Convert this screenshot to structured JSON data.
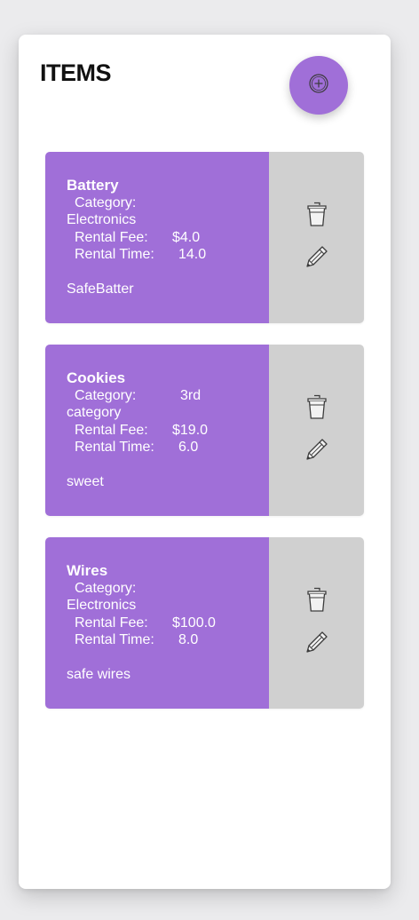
{
  "header": {
    "title": "ITEMS",
    "add_icon": "plus-circle-icon"
  },
  "colors": {
    "accent": "#a06fd8",
    "actions_bg": "#d0d0d0",
    "panel_bg": "#ffffff",
    "page_bg": "#ebebed"
  },
  "labels": {
    "category": "Category:",
    "rental_fee": "Rental Fee:",
    "rental_time": "Rental Time:"
  },
  "items": [
    {
      "name": "Battery",
      "category_line1": "",
      "category_line2": "Electronics",
      "rental_fee": "$4.0",
      "rental_time": "14.0",
      "description": "SafeBatter"
    },
    {
      "name": "Cookies",
      "category_line1": "3rd",
      "category_line2": "category",
      "rental_fee": "$19.0",
      "rental_time": "6.0",
      "description": "sweet"
    },
    {
      "name": "Wires",
      "category_line1": "",
      "category_line2": "Electronics",
      "rental_fee": "$100.0",
      "rental_time": "8.0",
      "description": "safe wires"
    }
  ]
}
